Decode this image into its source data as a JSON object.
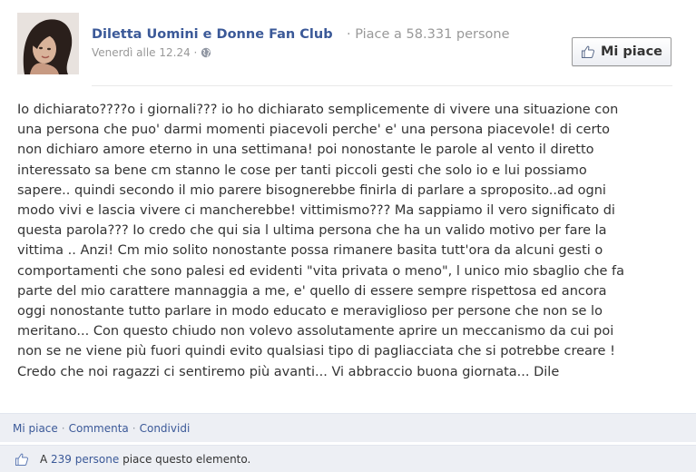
{
  "header": {
    "page_name": "Diletta Uomini e Donne Fan Club",
    "separator": " · ",
    "likes_label": "Piace a 58.331 persone",
    "timestamp": "Venerdì alle 12.24",
    "meta_separator": " · ",
    "privacy_icon": "globe-icon"
  },
  "like_button": {
    "icon": "thumbs-up-icon",
    "label": "Mi piace"
  },
  "post": {
    "text": "Io dichiarato????o i giornali??? io ho dichiarato semplicemente di vivere una situazione con\nuna persona che puo' darmi momenti piacevoli perche' e' una persona piacevole! di certo\nnon dichiaro amore eterno in una settimana! poi nonostante le parole al vento il diretto\ninteressato sa bene cm stanno le cose per tanti piccoli gesti che solo io e lui possiamo\nsapere.. quindi secondo il mio parere bisognerebbe finirla di parlare a sproposito..ad ogni\nmodo vivi e lascia vivere ci mancherebbe! vittimismo??? Ma sappiamo il vero significato di\nquesta parola??? Io credo che qui sia l ultima persona che ha un valido motivo per fare la\nvittima .. Anzi! Cm mio solito nonostante possa rimanere basita tutt'ora da alcuni gesti o\ncomportamenti che sono palesi ed evidenti \"vita privata o meno\", l unico mio sbaglio che fa\nparte del mio carattere mannaggia a me, e' quello di essere sempre rispettosa ed ancora\noggi nonostante tutto parlare in modo educato e meraviglioso per persone che non se lo\nmeritano... Con questo chiudo non volevo assolutamente aprire un meccanismo da cui poi\nnon se ne viene più fuori quindi evito qualsiasi tipo di pagliacciata che si potrebbe creare !\nCredo che noi ragazzi ci sentiremo più avanti... Vi abbraccio buona giornata... Dile"
  },
  "actions": {
    "like": "Mi piace",
    "comment": "Commenta",
    "share": "Condividi",
    "separator": "·"
  },
  "likes_summary": {
    "prefix": "A ",
    "people_link": "239 persone",
    "suffix": " piace questo elemento.",
    "icon": "thumbs-up-icon"
  },
  "colors": {
    "link": "#3b5998",
    "muted": "#999999",
    "bar_background": "#edeff4"
  }
}
